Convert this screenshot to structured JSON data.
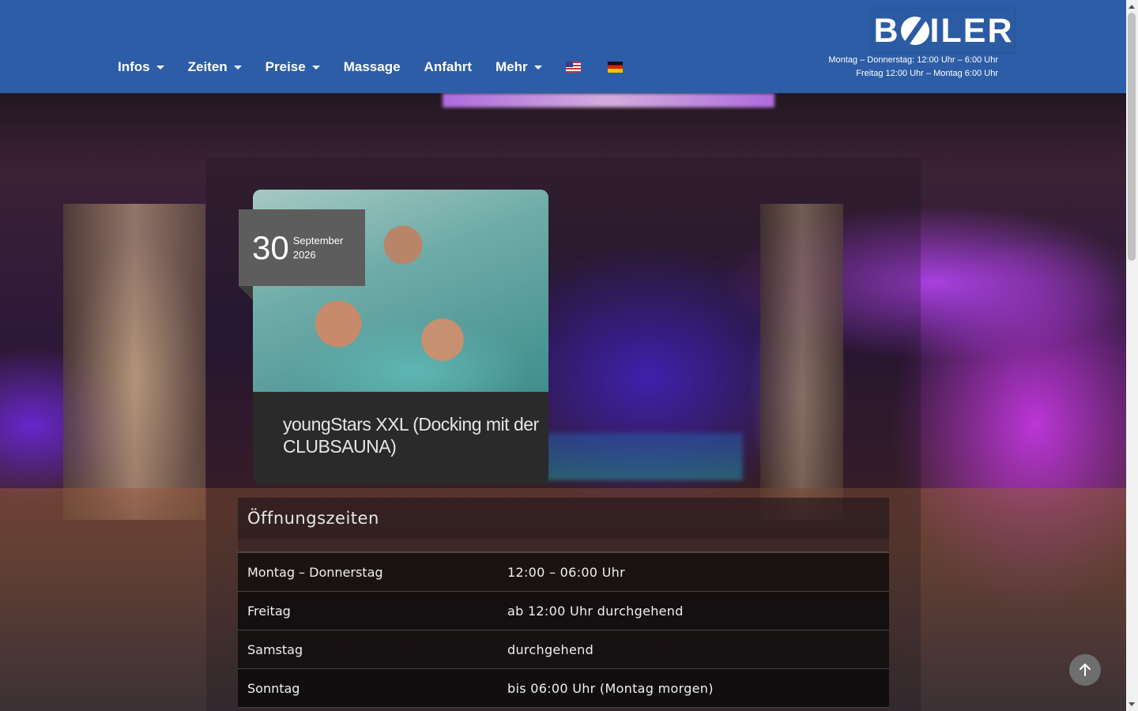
{
  "nav": {
    "items": [
      {
        "label": "Infos",
        "dropdown": true
      },
      {
        "label": "Zeiten",
        "dropdown": true
      },
      {
        "label": "Preise",
        "dropdown": true
      },
      {
        "label": "Massage",
        "dropdown": false
      },
      {
        "label": "Anfahrt",
        "dropdown": false
      },
      {
        "label": "Mehr",
        "dropdown": true
      }
    ],
    "flags": [
      "us-flag-icon",
      "de-flag-icon"
    ]
  },
  "brand": {
    "logo_left": "B",
    "logo_right": "ILER",
    "hours_line_1": "Montag – Donnerstag: 12:00 Uhr –  6:00 Uhr",
    "hours_line_2": "Freitag 12:00 Uhr – Montag 6:00 Uhr",
    "color": "#2d5da6"
  },
  "event": {
    "day": "30",
    "month": "September",
    "year": "2026",
    "title": "youngStars XXL (Docking mit der CLUBSAUNA)"
  },
  "hours": {
    "title": "Öffnungszeiten",
    "rows": [
      {
        "day": "Montag – Donnerstag",
        "time": "12:00 – 06:00 Uhr"
      },
      {
        "day": "Freitag",
        "time": "ab 12:00 Uhr durchgehend"
      },
      {
        "day": "Samstag",
        "time": "durchgehend"
      },
      {
        "day": "Sonntag",
        "time": "bis 06:00 Uhr (Montag morgen)"
      }
    ]
  },
  "icons": {
    "caret": "chevron-down-icon",
    "to_top": "arrow-up-icon"
  }
}
